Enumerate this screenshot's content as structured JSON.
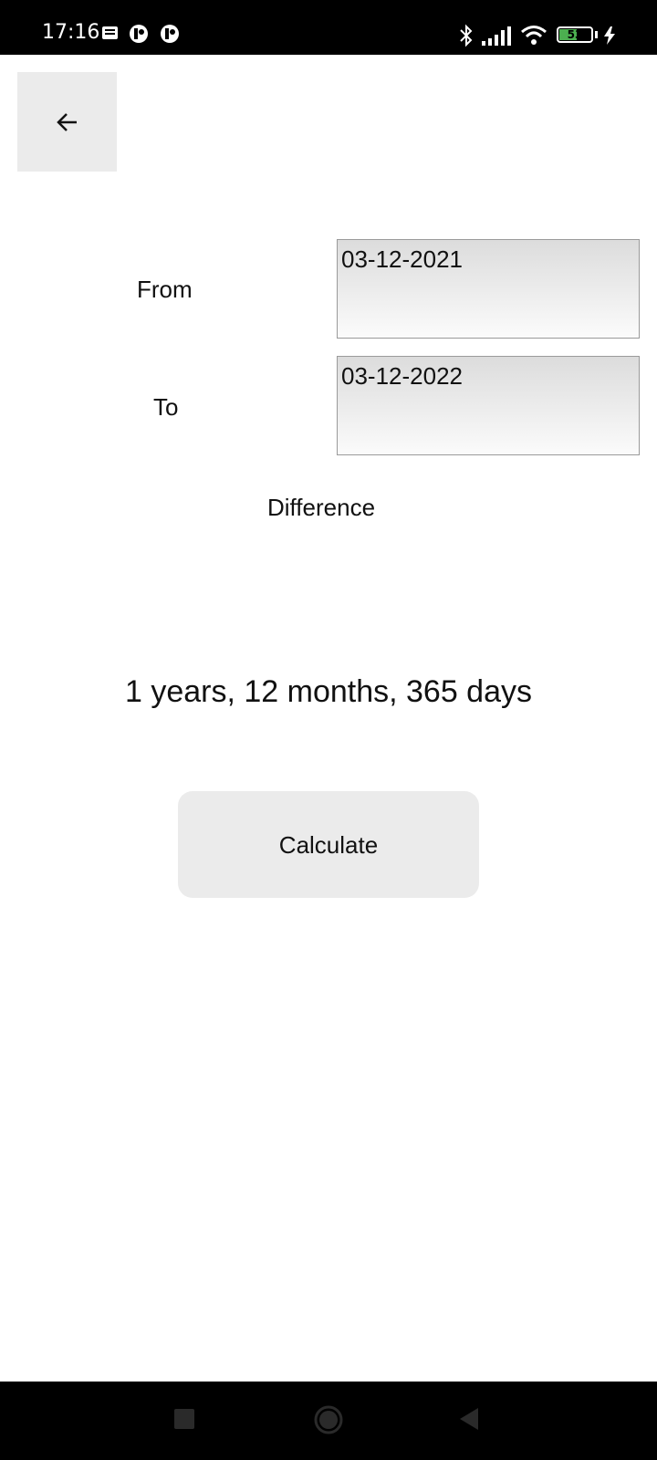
{
  "status_bar": {
    "time": "17:16",
    "battery_level": "53",
    "battery_color": "#4caf50",
    "icons": [
      "notification-icon",
      "app-icon",
      "app-icon",
      "bluetooth-icon",
      "signal-icon",
      "wifi-icon",
      "battery-icon",
      "charging-icon"
    ]
  },
  "toolbar": {
    "back_icon": "arrow-left-icon"
  },
  "form": {
    "from_label": "From",
    "from_value": "03-12-2021",
    "to_label": "To",
    "to_value": "03-12-2022",
    "difference_label": "Difference"
  },
  "result": {
    "text": "1 years, 12 months, 365 days"
  },
  "actions": {
    "calculate_label": "Calculate"
  },
  "nav_bar": {
    "items": [
      "recents-icon",
      "home-icon",
      "back-icon"
    ]
  }
}
